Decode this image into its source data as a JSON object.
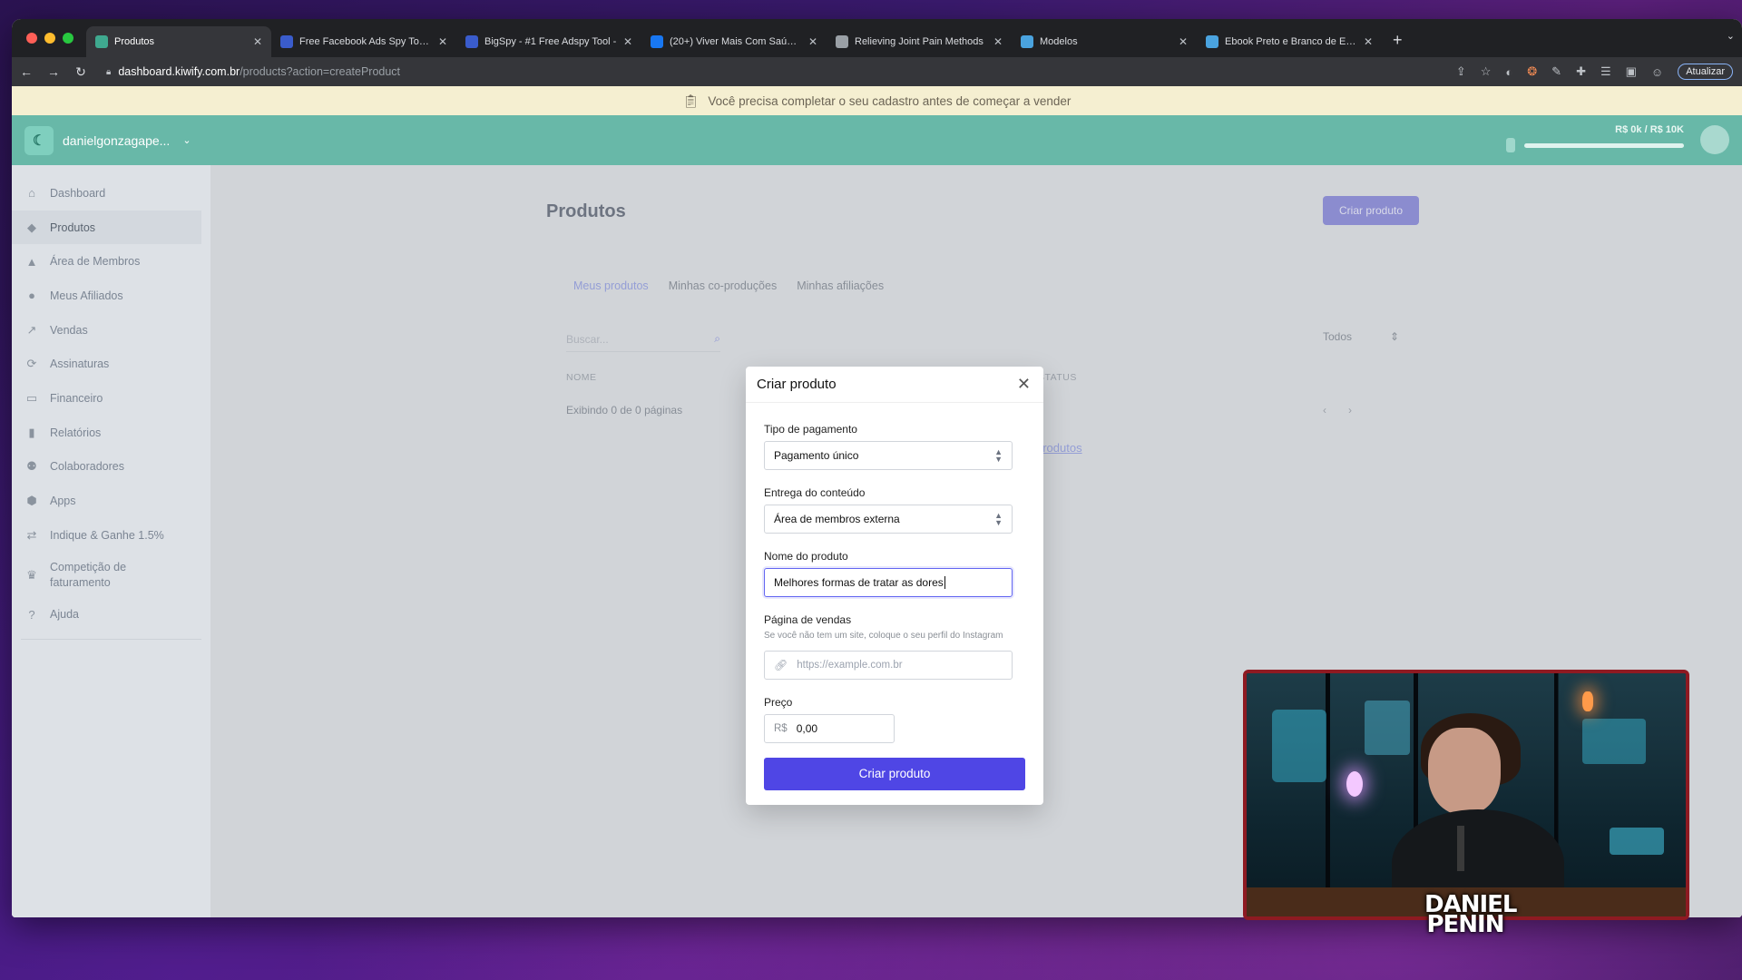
{
  "browser": {
    "tabs": [
      {
        "title": "Produtos",
        "favicon_color": "#3fa98f",
        "active": true
      },
      {
        "title": "Free Facebook Ads Spy Tools -",
        "favicon_color": "#3a5ccc"
      },
      {
        "title": "BigSpy - #1 Free Adspy Tool -",
        "favicon_color": "#3a5ccc"
      },
      {
        "title": "(20+) Viver Mais Com Saúde -",
        "favicon_color": "#1877f2"
      },
      {
        "title": "Relieving Joint Pain Methods",
        "favicon_color": "#9aa0a6"
      },
      {
        "title": "Modelos",
        "favicon_color": "#4aa3df"
      },
      {
        "title": "Ebook Preto e Branco de Estúd",
        "favicon_color": "#4aa3df"
      }
    ],
    "url_host": "dashboard.kiwify.com.br",
    "url_path": "/products?action=createProduct",
    "update_label": "Atualizar"
  },
  "banner": {
    "text": "Você precisa completar o seu cadastro antes de começar a vender"
  },
  "topbar": {
    "username": "danielgonzagape...",
    "goal_text": "R$ 0k / R$ 10K",
    "goal_progress": 0.0
  },
  "sidebar": {
    "items": [
      {
        "label": "Dashboard",
        "icon": "home-icon"
      },
      {
        "label": "Produtos",
        "icon": "tag-icon",
        "active": true
      },
      {
        "label": "Área de Membros",
        "icon": "graduation-cap-icon"
      },
      {
        "label": "Meus Afiliados",
        "icon": "user-icon"
      },
      {
        "label": "Vendas",
        "icon": "trend-icon"
      },
      {
        "label": "Assinaturas",
        "icon": "refresh-icon"
      },
      {
        "label": "Financeiro",
        "icon": "card-icon"
      },
      {
        "label": "Relatórios",
        "icon": "bar-chart-icon"
      },
      {
        "label": "Colaboradores",
        "icon": "users-icon"
      },
      {
        "label": "Apps",
        "icon": "apps-icon"
      },
      {
        "label": "Indique & Ganhe 1.5%",
        "icon": "share-icon"
      },
      {
        "label": "Competição de faturamento",
        "icon": "trophy-icon"
      },
      {
        "label": "Ajuda",
        "icon": "help-icon"
      }
    ]
  },
  "main": {
    "title": "Produtos",
    "create_button": "Criar produto",
    "tabs": [
      "Meus produtos",
      "Minhas co-produções",
      "Minhas afiliações"
    ],
    "search_placeholder": "Buscar...",
    "filter_value": "Todos",
    "col_name": "NOME",
    "col_status": "STATUS",
    "showing_text": "Exibindo 0 de 0 páginas",
    "link_text": "produtos"
  },
  "modal": {
    "title": "Criar produto",
    "payment_label": "Tipo de pagamento",
    "payment_value": "Pagamento único",
    "delivery_label": "Entrega do conteúdo",
    "delivery_value": "Área de membros externa",
    "name_label": "Nome do produto",
    "name_value": "Melhores formas de tratar as dores",
    "sales_label": "Página de vendas",
    "sales_help": "Se você não tem um site, coloque o seu perfil do Instagram",
    "sales_placeholder": "https://example.com.br",
    "price_label": "Preço",
    "price_currency": "R$",
    "price_value": "0,00",
    "submit_label": "Criar produto"
  },
  "webcam": {
    "name_line1": "DANIEL",
    "name_line2": "PENIN"
  }
}
